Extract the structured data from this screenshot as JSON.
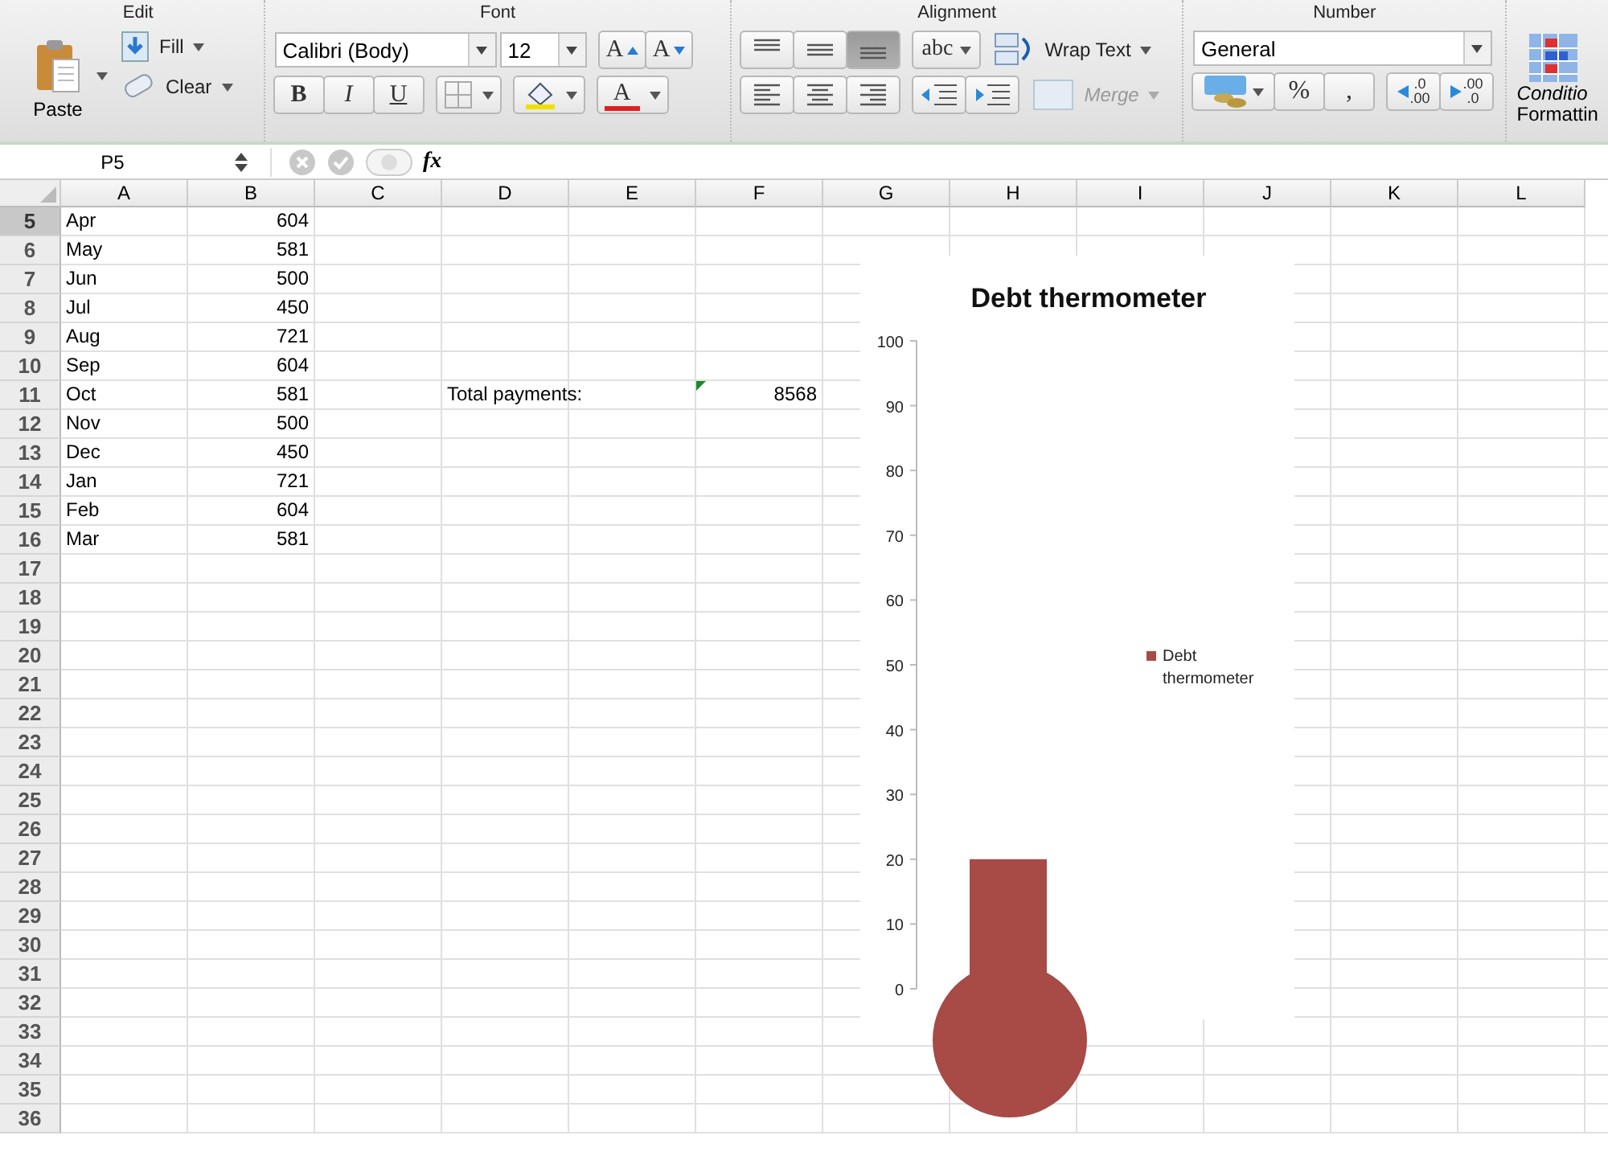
{
  "ribbon": {
    "edit": {
      "title": "Edit",
      "paste": "Paste",
      "fill": "Fill",
      "clear": "Clear"
    },
    "font": {
      "title": "Font",
      "font_name": "Calibri (Body)",
      "font_size": "12",
      "grow": "A",
      "shrink": "A",
      "bold": "B",
      "italic": "I",
      "underline": "U",
      "font_color": "A"
    },
    "alignment": {
      "title": "Alignment",
      "vertical": [
        {
          "selected": false
        },
        {
          "selected": false
        },
        {
          "selected": true
        }
      ],
      "horizontal": [
        {
          "selected": false
        },
        {
          "selected": false
        },
        {
          "selected": false
        }
      ],
      "orientation": "abc",
      "wrap_text": "Wrap Text",
      "merge": {
        "label": "Merge",
        "disabled": true
      }
    },
    "number": {
      "title": "Number",
      "format": "General",
      "percent": "%",
      "comma": ",",
      "increase_decimal": [
        ".0",
        ".00"
      ],
      "decrease_decimal": [
        ".00",
        ".0"
      ]
    },
    "conditional": {
      "line_1": "Conditio",
      "line_2": "Formattin"
    }
  },
  "formula_bar": {
    "name_box": "P5",
    "fx": "fx"
  },
  "sheet": {
    "columns": [
      "A",
      "B",
      "C",
      "D",
      "E",
      "F",
      "G",
      "H",
      "I",
      "J",
      "K",
      "L"
    ],
    "rows": [
      {
        "number": "5",
        "selected": true,
        "cells": [
          {
            "text": "Apr",
            "kind": "text",
            "error_flag": false
          },
          {
            "text": "604",
            "kind": "number",
            "error_flag": false
          }
        ]
      },
      {
        "number": "6",
        "selected": false,
        "cells": [
          {
            "text": "May",
            "kind": "text",
            "error_flag": false
          },
          {
            "text": "581",
            "kind": "number",
            "error_flag": false
          }
        ]
      },
      {
        "number": "7",
        "selected": false,
        "cells": [
          {
            "text": "Jun",
            "kind": "text",
            "error_flag": false
          },
          {
            "text": "500",
            "kind": "number",
            "error_flag": false
          }
        ]
      },
      {
        "number": "8",
        "selected": false,
        "cells": [
          {
            "text": "Jul",
            "kind": "text",
            "error_flag": false
          },
          {
            "text": "450",
            "kind": "number",
            "error_flag": false
          }
        ]
      },
      {
        "number": "9",
        "selected": false,
        "cells": [
          {
            "text": "Aug",
            "kind": "text",
            "error_flag": false
          },
          {
            "text": "721",
            "kind": "number",
            "error_flag": false
          }
        ]
      },
      {
        "number": "10",
        "selected": false,
        "cells": [
          {
            "text": "Sep",
            "kind": "text",
            "error_flag": false
          },
          {
            "text": "604",
            "kind": "number",
            "error_flag": false
          }
        ]
      },
      {
        "number": "11",
        "selected": false,
        "cells": [
          {
            "text": "Oct",
            "kind": "text",
            "error_flag": false
          },
          {
            "text": "581",
            "kind": "number",
            "error_flag": false
          },
          {
            "text": ""
          },
          {
            "text": "Total payments:",
            "kind": "text",
            "error_flag": false
          },
          {
            "text": ""
          },
          {
            "text": "8568",
            "kind": "number",
            "error_flag": true
          }
        ]
      },
      {
        "number": "12",
        "selected": false,
        "cells": [
          {
            "text": "Nov",
            "kind": "text",
            "error_flag": false
          },
          {
            "text": "500",
            "kind": "number",
            "error_flag": false
          }
        ]
      },
      {
        "number": "13",
        "selected": false,
        "cells": [
          {
            "text": "Dec",
            "kind": "text",
            "error_flag": false
          },
          {
            "text": "450",
            "kind": "number",
            "error_flag": false
          }
        ]
      },
      {
        "number": "14",
        "selected": false,
        "cells": [
          {
            "text": "Jan",
            "kind": "text",
            "error_flag": false
          },
          {
            "text": "721",
            "kind": "number",
            "error_flag": false
          }
        ]
      },
      {
        "number": "15",
        "selected": false,
        "cells": [
          {
            "text": "Feb",
            "kind": "text",
            "error_flag": false
          },
          {
            "text": "604",
            "kind": "number",
            "error_flag": false
          }
        ]
      },
      {
        "number": "16",
        "selected": false,
        "cells": [
          {
            "text": "Mar",
            "kind": "text",
            "error_flag": false
          },
          {
            "text": "581",
            "kind": "number",
            "error_flag": false
          }
        ]
      },
      {
        "number": "17",
        "selected": false
      },
      {
        "number": "18",
        "selected": false
      },
      {
        "number": "19",
        "selected": false
      },
      {
        "number": "20",
        "selected": false
      },
      {
        "number": "21",
        "selected": false
      },
      {
        "number": "22",
        "selected": false
      },
      {
        "number": "23",
        "selected": false
      },
      {
        "number": "24",
        "selected": false
      },
      {
        "number": "25",
        "selected": false
      },
      {
        "number": "26",
        "selected": false
      },
      {
        "number": "27",
        "selected": false
      },
      {
        "number": "28",
        "selected": false
      },
      {
        "number": "29",
        "selected": false
      },
      {
        "number": "30",
        "selected": false
      },
      {
        "number": "31",
        "selected": false
      },
      {
        "number": "32",
        "selected": false
      },
      {
        "number": "33",
        "selected": false
      },
      {
        "number": "34",
        "selected": false
      },
      {
        "number": "35",
        "selected": false
      },
      {
        "number": "36",
        "selected": false
      }
    ]
  },
  "chart": {
    "chart_data": {
      "type": "bar",
      "title": "Debt thermometer",
      "series": [
        {
          "name": "Debt thermometer",
          "color": "#a84a46",
          "values": [
            20
          ]
        }
      ],
      "ylim": [
        0,
        100
      ],
      "yticks": [
        0,
        10,
        20,
        30,
        40,
        50,
        60,
        70,
        80,
        90,
        100
      ]
    }
  }
}
